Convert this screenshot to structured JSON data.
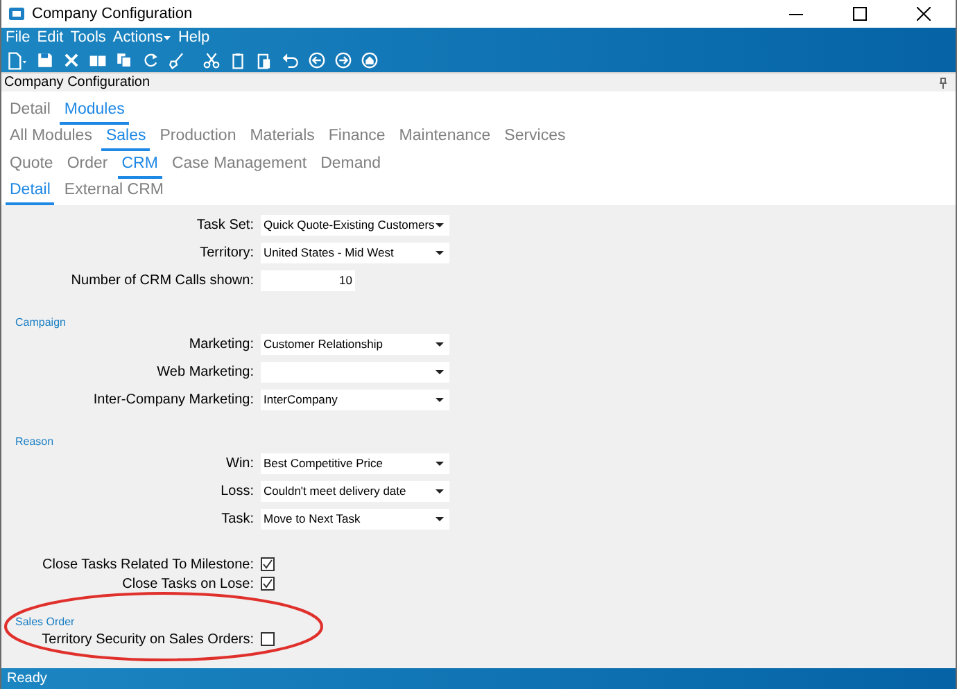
{
  "window": {
    "title": "Company Configuration"
  },
  "menu": [
    {
      "label": "File",
      "has_submenu": false
    },
    {
      "label": "Edit",
      "has_submenu": false
    },
    {
      "label": "Tools",
      "has_submenu": false
    },
    {
      "label": "Actions",
      "has_submenu": true
    },
    {
      "label": "Help",
      "has_submenu": false
    }
  ],
  "panel_title": "Company Configuration",
  "tab_rows": [
    [
      {
        "label": "Detail",
        "selected": false
      },
      {
        "label": "Modules",
        "selected": true
      }
    ],
    [
      {
        "label": "All Modules",
        "selected": false
      },
      {
        "label": "Sales",
        "selected": true
      },
      {
        "label": "Production",
        "selected": false
      },
      {
        "label": "Materials",
        "selected": false
      },
      {
        "label": "Finance",
        "selected": false
      },
      {
        "label": "Maintenance",
        "selected": false
      },
      {
        "label": "Services",
        "selected": false
      }
    ],
    [
      {
        "label": "Quote",
        "selected": false
      },
      {
        "label": "Order",
        "selected": false
      },
      {
        "label": "CRM",
        "selected": true
      },
      {
        "label": "Case Management",
        "selected": false
      },
      {
        "label": "Demand",
        "selected": false
      }
    ],
    [
      {
        "label": "Detail",
        "selected": true
      },
      {
        "label": "External CRM",
        "selected": false
      }
    ]
  ],
  "sections": [
    {
      "fields": [
        {
          "kind": "select",
          "label": "Task Set:",
          "value": "Quick Quote-Existing Customers"
        },
        {
          "kind": "select",
          "label": "Territory:",
          "value": "United States - Mid West"
        },
        {
          "kind": "number",
          "label": "Number of CRM Calls shown:",
          "value": "10"
        }
      ]
    },
    {
      "heading": "Campaign",
      "fields": [
        {
          "kind": "select",
          "label": "Marketing:",
          "value": "Customer Relationship"
        },
        {
          "kind": "select",
          "label": "Web Marketing:"
        },
        {
          "kind": "select",
          "label": "Inter-Company Marketing:",
          "value": "InterCompany"
        }
      ]
    },
    {
      "heading": "Reason",
      "fields": [
        {
          "kind": "select",
          "label": "Win:",
          "value": "Best Competitive Price"
        },
        {
          "kind": "select",
          "label": "Loss:",
          "value": "Couldn't meet delivery date"
        },
        {
          "kind": "select",
          "label": "Task:",
          "value": "Move to Next Task"
        }
      ]
    },
    {
      "fields": [
        {
          "kind": "checkbox",
          "label": "Close Tasks Related To Milestone:",
          "checked": true
        },
        {
          "kind": "checkbox",
          "label": "Close Tasks on Lose:",
          "checked": true
        }
      ]
    },
    {
      "heading": "Sales Order",
      "fields": [
        {
          "kind": "checkbox",
          "label": "Territory Security on Sales Orders:",
          "checked": false
        }
      ]
    }
  ],
  "status_bar": "Ready"
}
